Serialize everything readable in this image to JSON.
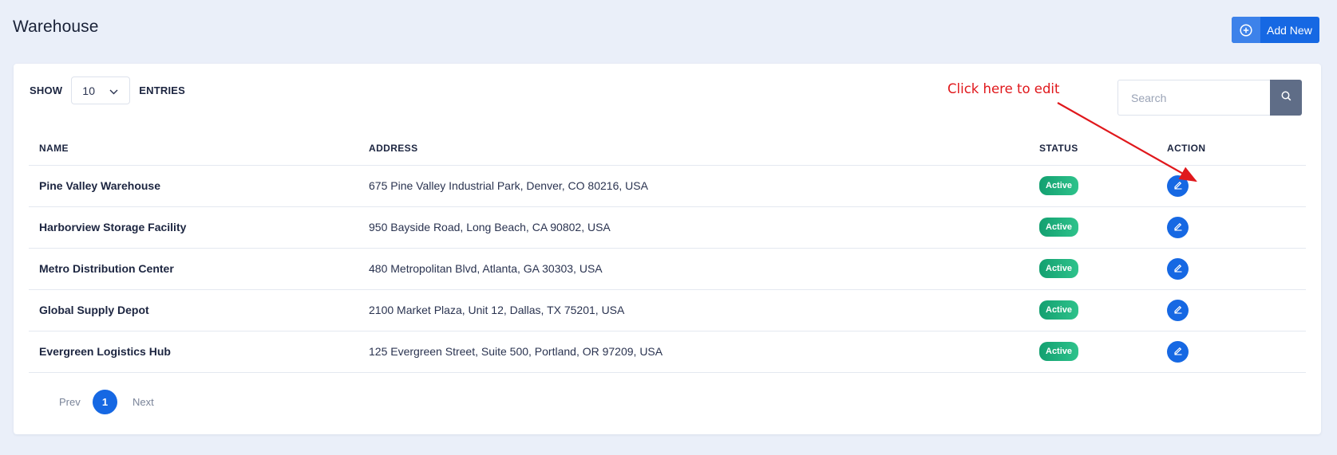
{
  "page": {
    "title": "Warehouse",
    "add_button_label": "Add New"
  },
  "controls": {
    "show_label": "SHOW",
    "entries_value": "10",
    "entries_label": "ENTRIES",
    "search_placeholder": "Search"
  },
  "annotation": {
    "text": "Click here to edit",
    "color": "#e0181c"
  },
  "table": {
    "headers": {
      "name": "NAME",
      "address": "ADDRESS",
      "status": "STATUS",
      "action": "ACTION"
    },
    "rows": [
      {
        "name": "Pine Valley Warehouse",
        "address": "675 Pine Valley Industrial Park, Denver, CO 80216, USA",
        "status": "Active"
      },
      {
        "name": "Harborview Storage Facility",
        "address": "950 Bayside Road, Long Beach, CA 90802, USA",
        "status": "Active"
      },
      {
        "name": "Metro Distribution Center",
        "address": "480 Metropolitan Blvd, Atlanta, GA 30303, USA",
        "status": "Active"
      },
      {
        "name": "Global Supply Depot",
        "address": "2100 Market Plaza, Unit 12, Dallas, TX 75201, USA",
        "status": "Active"
      },
      {
        "name": "Evergreen Logistics Hub",
        "address": "125 Evergreen Street, Suite 500, Portland, OR 97209, USA",
        "status": "Active"
      }
    ]
  },
  "pagination": {
    "prev": "Prev",
    "current": "1",
    "next": "Next"
  },
  "colors": {
    "primary": "#1668e3",
    "status_active": "#13a070",
    "background": "#eaeff9"
  },
  "icons": {
    "add": "plus-circle-icon",
    "dropdown": "chevron-down-icon",
    "search": "search-icon",
    "edit": "pencil-icon"
  }
}
